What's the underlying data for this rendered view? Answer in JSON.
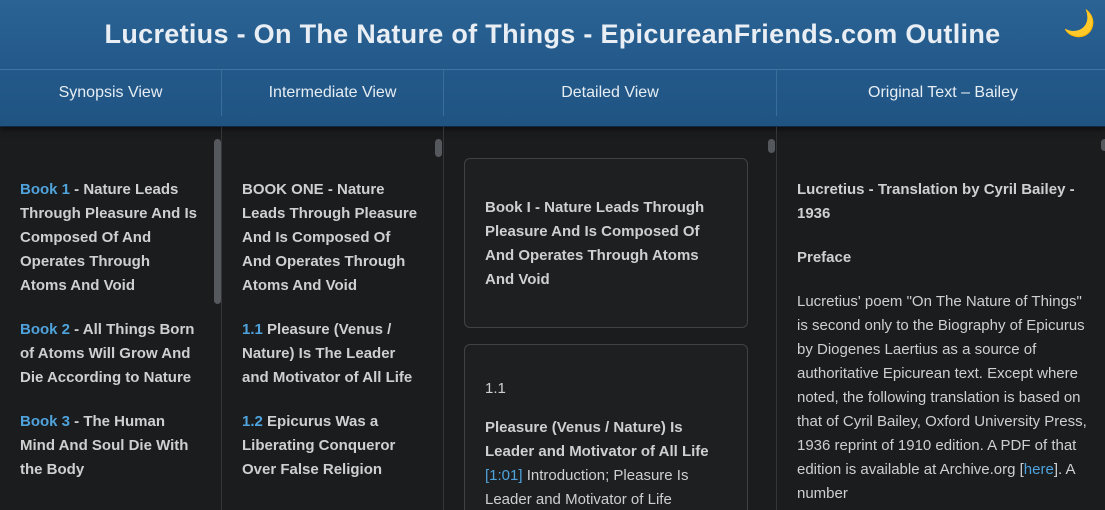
{
  "header": {
    "title": "Lucretius - On The Nature of Things - EpicureanFriends.com Outline",
    "theme_icon": "crescent-moon-icon"
  },
  "tabs": [
    {
      "label": "Synopsis View"
    },
    {
      "label": "Intermediate View"
    },
    {
      "label": "Detailed View"
    },
    {
      "label": "Original Text – Bailey"
    }
  ],
  "synopsis": {
    "items": [
      {
        "book": "Book 1",
        "title": " - Nature Leads Through Pleasure And Is Composed Of And Operates Through Atoms And Void"
      },
      {
        "book": "Book 2",
        "title": " - All Things Born of Atoms Will Grow And Die According to Nature"
      },
      {
        "book": "Book 3",
        "title": " - The Human Mind And Soul Die With the Body"
      }
    ]
  },
  "intermediate": {
    "book_heading": "BOOK ONE - Nature Leads Through Pleasure And Is Composed Of And Operates Through Atoms And Void",
    "sections": [
      {
        "num": "1.1",
        "title": " Pleasure (Venus / Nature) Is The Leader and Motivator of All Life"
      },
      {
        "num": "1.2",
        "title": " Epicurus Was a Liberating Conqueror Over False Religion"
      }
    ]
  },
  "detailed": {
    "card1_title": "Book I - Nature Leads Through Pleasure And Is Composed Of And Operates Through Atoms And Void",
    "card2_num": "1.1",
    "card2_title": "Pleasure (Venus / Nature) Is Leader and Motivator of All Life",
    "card2_ref": "[1:01]",
    "card2_text": " Introduction; Pleasure Is Leader and Motivator of Life"
  },
  "original": {
    "heading": "Lucretius - Translation by Cyril Bailey - 1936",
    "preface": "Preface",
    "body_before_link": "Lucretius' poem \"On The Nature of Things\" is second only to the Biography of Epicurus by Diogenes Laertius as a source of authoritative Epicurean text.  Except where noted, the following translation is based on that of Cyril Bailey, Oxford University Press, 1936 reprint of 1910 edition.  A PDF of that edition is available at Archive.org [",
    "link_text": "here",
    "body_after_link": "].  A number"
  },
  "colors": {
    "header_blue": "#23598a",
    "link_blue": "#4fa3dc",
    "background": "#1b1c1e",
    "moon_yellow": "#f2c230"
  }
}
